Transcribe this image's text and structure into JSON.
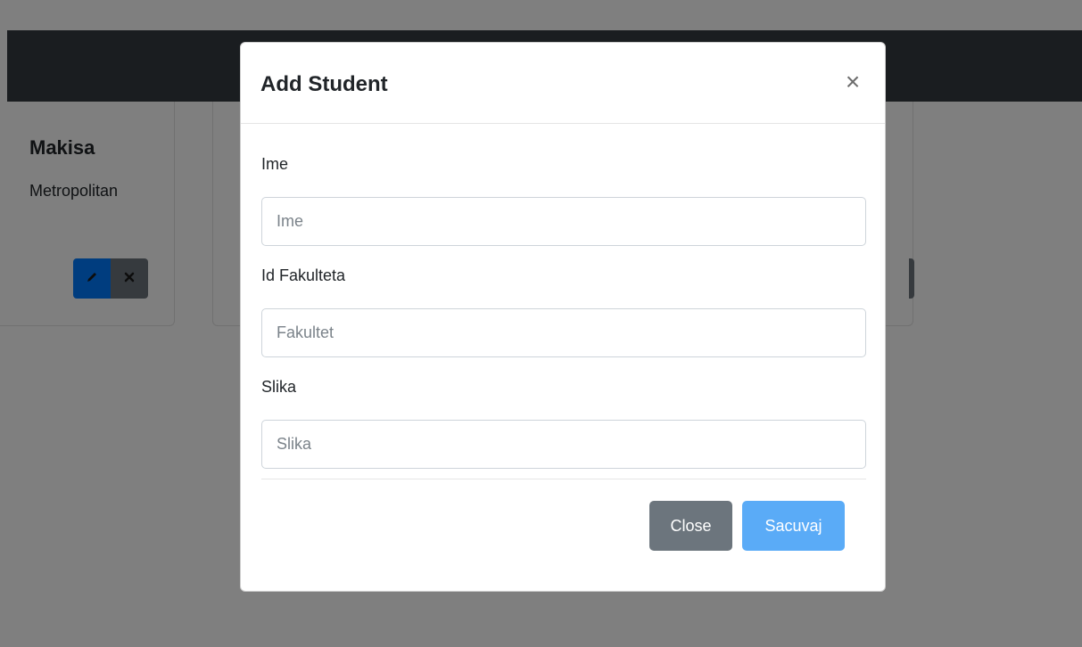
{
  "background": {
    "card": {
      "title": "Makisa",
      "subtitle": "Metropolitan",
      "edit_icon": "pencil-icon",
      "delete_icon": "x-icon"
    }
  },
  "modal": {
    "title": "Add Student",
    "close_icon": "×",
    "fields": [
      {
        "label": "Ime",
        "placeholder": "Ime",
        "value": ""
      },
      {
        "label": "Id Fakulteta",
        "placeholder": "Fakultet",
        "value": ""
      },
      {
        "label": "Slika",
        "placeholder": "Slika",
        "value": ""
      }
    ],
    "buttons": {
      "close_label": "Close",
      "save_label": "Sacuvaj"
    }
  },
  "colors": {
    "navbar": "#343a40",
    "primary": "#007bff",
    "primary_disabled": "#5aabf7",
    "secondary": "#6c757d"
  }
}
